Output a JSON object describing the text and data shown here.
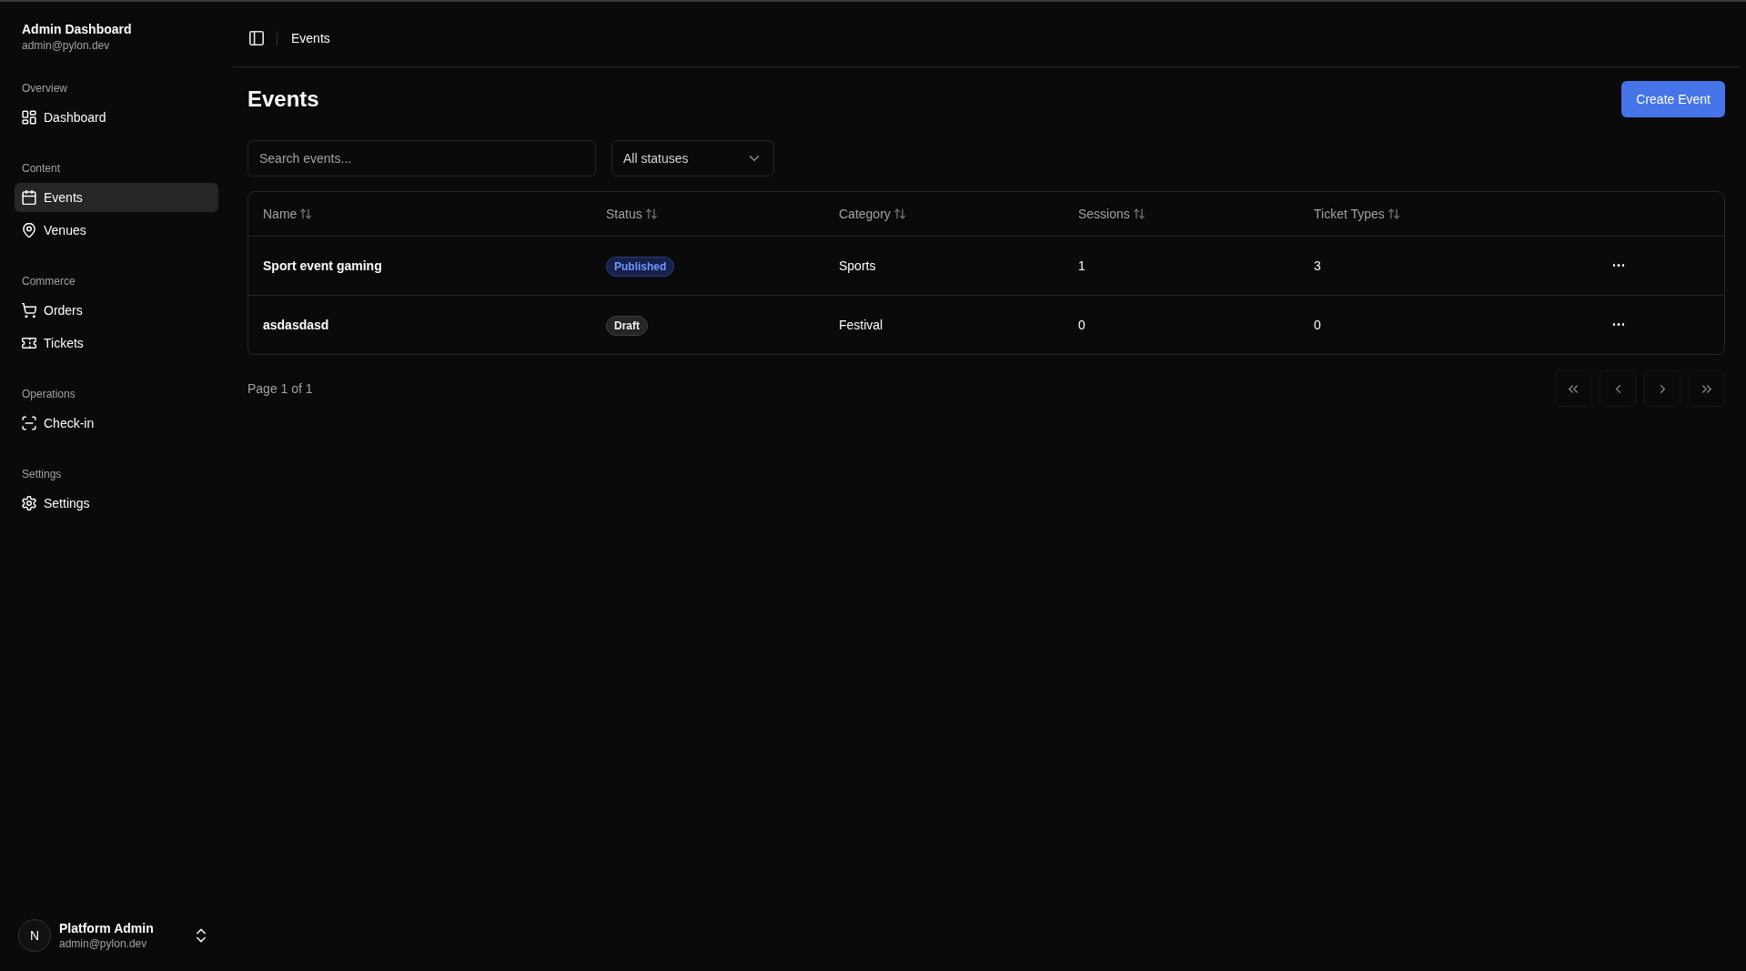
{
  "sidebar": {
    "header": {
      "title": "Admin Dashboard",
      "subtitle": "admin@pylon.dev"
    },
    "groups": [
      {
        "label": "Overview",
        "items": [
          {
            "label": "Dashboard",
            "selected": false
          }
        ]
      },
      {
        "label": "Content",
        "items": [
          {
            "label": "Events",
            "selected": true
          },
          {
            "label": "Venues",
            "selected": false
          }
        ]
      },
      {
        "label": "Commerce",
        "items": [
          {
            "label": "Orders",
            "selected": false
          },
          {
            "label": "Tickets",
            "selected": false
          }
        ]
      },
      {
        "label": "Operations",
        "items": [
          {
            "label": "Check-in",
            "selected": false
          }
        ]
      },
      {
        "label": "Settings",
        "items": [
          {
            "label": "Settings",
            "selected": false
          }
        ]
      }
    ],
    "user": {
      "avatar_text": "N",
      "name": "Platform Admin",
      "email": "admin@pylon.dev"
    }
  },
  "header": {
    "breadcrumb": "Events"
  },
  "page": {
    "title": "Events",
    "create_button": "Create Event"
  },
  "filters": {
    "search": {
      "placeholder": "Search events..."
    },
    "status_select": {
      "value": "All statuses"
    }
  },
  "table": {
    "columns": [
      {
        "label": "Name",
        "sortable": true
      },
      {
        "label": "Status",
        "sortable": true
      },
      {
        "label": "Category",
        "sortable": true
      },
      {
        "label": "Sessions",
        "sortable": true
      },
      {
        "label": "Ticket Types",
        "sortable": true
      }
    ],
    "rows": [
      {
        "name": "Sport event gaming",
        "status": {
          "text": "Published",
          "kind": "published"
        },
        "category": "Sports",
        "sessions": "1",
        "ticket_types": "3"
      },
      {
        "name": "asdasdasd",
        "status": {
          "text": "Draft",
          "kind": "draft"
        },
        "category": "Festival",
        "sessions": "0",
        "ticket_types": "0"
      }
    ]
  },
  "pagination": {
    "label": "Page 1 of 1",
    "buttons": [
      {
        "kind": "first",
        "disabled": true
      },
      {
        "kind": "previous",
        "disabled": true
      },
      {
        "kind": "next",
        "disabled": true
      },
      {
        "kind": "last",
        "disabled": true
      }
    ]
  }
}
